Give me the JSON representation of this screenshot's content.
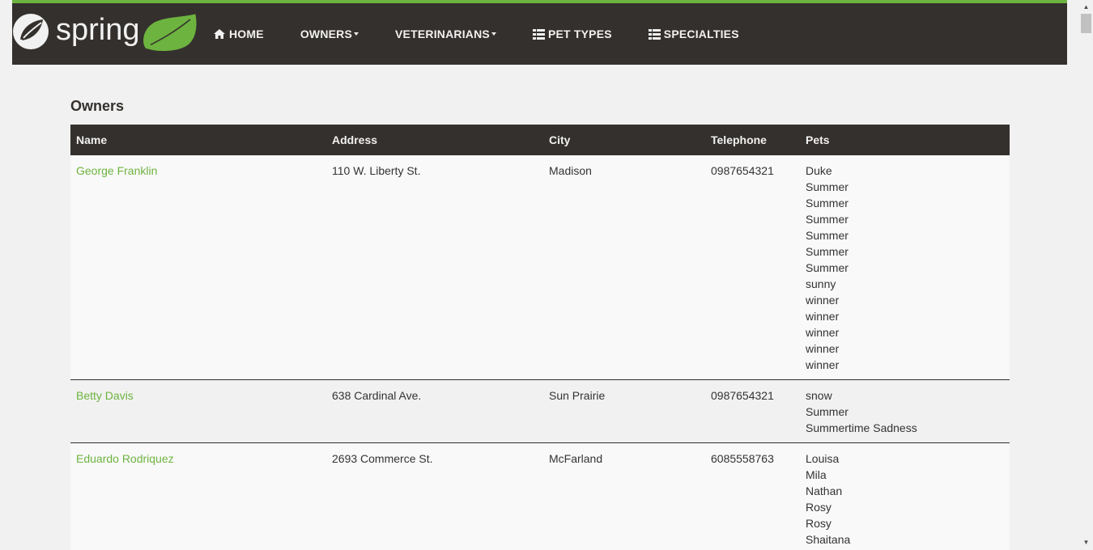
{
  "navbar": {
    "brand": "spring",
    "items": [
      {
        "label": "HOME",
        "icon": "home-icon",
        "dropdown": false
      },
      {
        "label": "OWNERS",
        "icon": "",
        "dropdown": true
      },
      {
        "label": "VETERINARIANS",
        "icon": "",
        "dropdown": true
      },
      {
        "label": "PET TYPES",
        "icon": "list-icon",
        "dropdown": false
      },
      {
        "label": "SPECIALTIES",
        "icon": "list-icon",
        "dropdown": false
      }
    ]
  },
  "page": {
    "title": "Owners"
  },
  "table": {
    "headers": [
      "Name",
      "Address",
      "City",
      "Telephone",
      "Pets"
    ],
    "rows": [
      {
        "name": "George Franklin",
        "address": "110 W. Liberty St.",
        "city": "Madison",
        "telephone": "0987654321",
        "pets": [
          "Duke",
          "Summer",
          "Summer",
          "Summer",
          "Summer",
          "Summer",
          "Summer",
          "sunny",
          "winner",
          "winner",
          "winner",
          "winner",
          "winner"
        ]
      },
      {
        "name": "Betty Davis",
        "address": "638 Cardinal Ave.",
        "city": "Sun Prairie",
        "telephone": "0987654321",
        "pets": [
          "snow",
          "Summer",
          "Summertime Sadness"
        ]
      },
      {
        "name": "Eduardo Rodriquez",
        "address": "2693 Commerce St.",
        "city": "McFarland",
        "telephone": "6085558763",
        "pets": [
          "Louisa",
          "Mila",
          "Nathan",
          "Rosy",
          "Rosy",
          "Shaitana"
        ]
      }
    ]
  },
  "colors": {
    "nav_bg": "#34302d",
    "accent_green": "#6db33f",
    "page_bg": "#f1f1f1"
  }
}
